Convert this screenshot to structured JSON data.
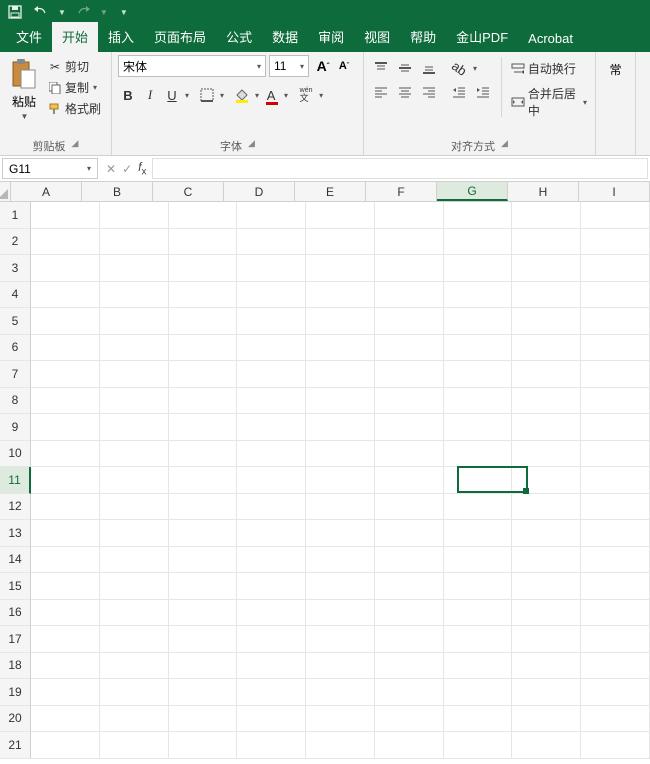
{
  "qat": {
    "save": "save-icon",
    "undo": "undo-icon",
    "redo": "redo-icon"
  },
  "tabs": {
    "file": "文件",
    "home": "开始",
    "insert": "插入",
    "layout": "页面布局",
    "formulas": "公式",
    "data": "数据",
    "review": "审阅",
    "view": "视图",
    "help": "帮助",
    "jinshan": "金山PDF",
    "acrobat": "Acrobat"
  },
  "clipboard": {
    "paste": "粘贴",
    "cut": "剪切",
    "copy": "复制",
    "format": "格式刷",
    "group": "剪贴板"
  },
  "font": {
    "name": "宋体",
    "size": "11",
    "group": "字体",
    "bold": "B",
    "italic": "I",
    "underline": "U",
    "wenA": "wén"
  },
  "alignment": {
    "wrap": "自动换行",
    "merge": "合并后居中",
    "group": "对齐方式"
  },
  "normal_partial": "常",
  "namebox": "G11",
  "columns": [
    "A",
    "B",
    "C",
    "D",
    "E",
    "F",
    "G",
    "H",
    "I"
  ],
  "rows": [
    "1",
    "2",
    "3",
    "4",
    "5",
    "6",
    "7",
    "8",
    "9",
    "10",
    "11",
    "12",
    "13",
    "14",
    "15",
    "16",
    "17",
    "18",
    "19",
    "20",
    "21"
  ],
  "selected": {
    "col": "G",
    "row": "11",
    "colIndex": 6,
    "rowIndex": 10
  }
}
